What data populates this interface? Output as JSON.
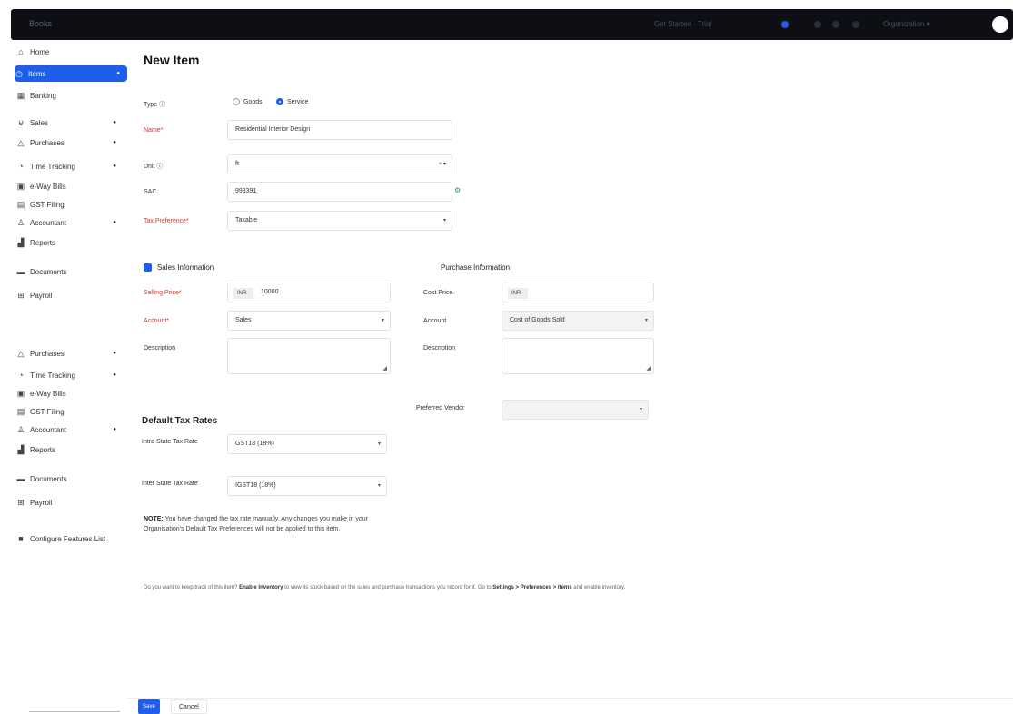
{
  "topbar": {
    "brand": "Books",
    "center_text": "Get Started · Trial",
    "org_text": "Organization ▾",
    "accent": "#1e5ee8"
  },
  "sidebar": {
    "items": [
      {
        "label": "Home",
        "icon": "home-icon",
        "glyph": "⌂",
        "arrow": false,
        "active": false
      },
      {
        "label": "Items",
        "icon": "tag-icon",
        "glyph": "◷",
        "arrow": true,
        "active": true
      },
      {
        "label": "Banking",
        "icon": "bank-icon",
        "glyph": "▦",
        "arrow": false,
        "active": false
      },
      {
        "label": "Sales",
        "icon": "cart-icon",
        "glyph": "⊌",
        "arrow": true,
        "active": false
      },
      {
        "label": "Purchases",
        "icon": "bag-icon",
        "glyph": "△",
        "arrow": true,
        "active": false
      },
      {
        "label": "Time Tracking",
        "icon": "clock-icon",
        "glyph": "◔",
        "arrow": true,
        "active": false
      },
      {
        "label": "e-Way Bills",
        "icon": "truck-icon",
        "glyph": "▣",
        "arrow": false,
        "active": false
      },
      {
        "label": "GST Filing",
        "icon": "file-icon",
        "glyph": "▤",
        "arrow": false,
        "active": false
      },
      {
        "label": "Accountant",
        "icon": "person-icon",
        "glyph": "♙",
        "arrow": true,
        "active": false
      },
      {
        "label": "Reports",
        "icon": "chart-icon",
        "glyph": "▟",
        "arrow": false,
        "active": false
      },
      {
        "label": "Documents",
        "icon": "folder-icon",
        "glyph": "▬",
        "arrow": false,
        "active": false
      },
      {
        "label": "Payroll",
        "icon": "payroll-icon",
        "glyph": "⊞",
        "arrow": false,
        "active": false
      },
      {
        "label": "Purchases",
        "icon": "bag-icon",
        "glyph": "△",
        "arrow": true,
        "active": false
      },
      {
        "label": "Time Tracking",
        "icon": "clock-icon",
        "glyph": "◔",
        "arrow": true,
        "active": false
      },
      {
        "label": "e-Way Bills",
        "icon": "truck-icon",
        "glyph": "▣",
        "arrow": false,
        "active": false
      },
      {
        "label": "GST Filing",
        "icon": "file-icon",
        "glyph": "▤",
        "arrow": false,
        "active": false
      },
      {
        "label": "Accountant",
        "icon": "person-icon",
        "glyph": "♙",
        "arrow": true,
        "active": false
      },
      {
        "label": "Reports",
        "icon": "chart-icon",
        "glyph": "▟",
        "arrow": false,
        "active": false
      },
      {
        "label": "Documents",
        "icon": "folder-icon",
        "glyph": "▬",
        "arrow": false,
        "active": false
      },
      {
        "label": "Payroll",
        "icon": "payroll-icon",
        "glyph": "⊞",
        "arrow": false,
        "active": false
      },
      {
        "label": "Configure Features List",
        "icon": "settings-icon",
        "glyph": "■",
        "arrow": false,
        "active": false
      }
    ]
  },
  "form": {
    "title": "New Item",
    "type_label": "Type ⓘ",
    "type_goods": "Goods",
    "type_service": "Service",
    "name_label": "Name*",
    "name_value": "Residential Interior Design",
    "unit_label": "Unit ⓘ",
    "unit_value": "ft",
    "sac_label": "SAC",
    "sac_value": "998391",
    "tax_pref_label": "Tax Preference*",
    "tax_pref_value": "Taxable"
  },
  "sales": {
    "heading": "Sales Information",
    "selling_price_label": "Selling Price*",
    "currency": "INR",
    "selling_price_value": "10000",
    "account_label": "Account*",
    "account_value": "Sales",
    "description_label": "Description"
  },
  "purchase": {
    "heading": "Purchase Information",
    "cost_price_label": "Cost Price",
    "currency": "INR",
    "account_label": "Account",
    "account_value": "Cost of Goods Sold",
    "description_label": "Description",
    "vendor_label": "Preferred Vendor"
  },
  "tax": {
    "title": "Default Tax Rates",
    "intra_label": "Intra State Tax Rate",
    "intra_value": "GST18 (18%)",
    "inter_label": "Inter State Tax Rate",
    "inter_value": "IGST18 (18%)",
    "note_prefix": "NOTE:",
    "note_text": "You have changed the tax rate manually. Any changes you make in your Organisation's Default Tax Preferences will not be applied to this item."
  },
  "inventory_note": {
    "pre": "Do you want to keep track of this item?",
    "link1": "Enable Inventory",
    "mid": "to view its stock based on the sales and purchase transactions you record for it. Go to",
    "link2": "Settings > Preferences > Items",
    "post": "and enable inventory."
  },
  "actions": {
    "save": "Save",
    "cancel": "Cancel"
  }
}
